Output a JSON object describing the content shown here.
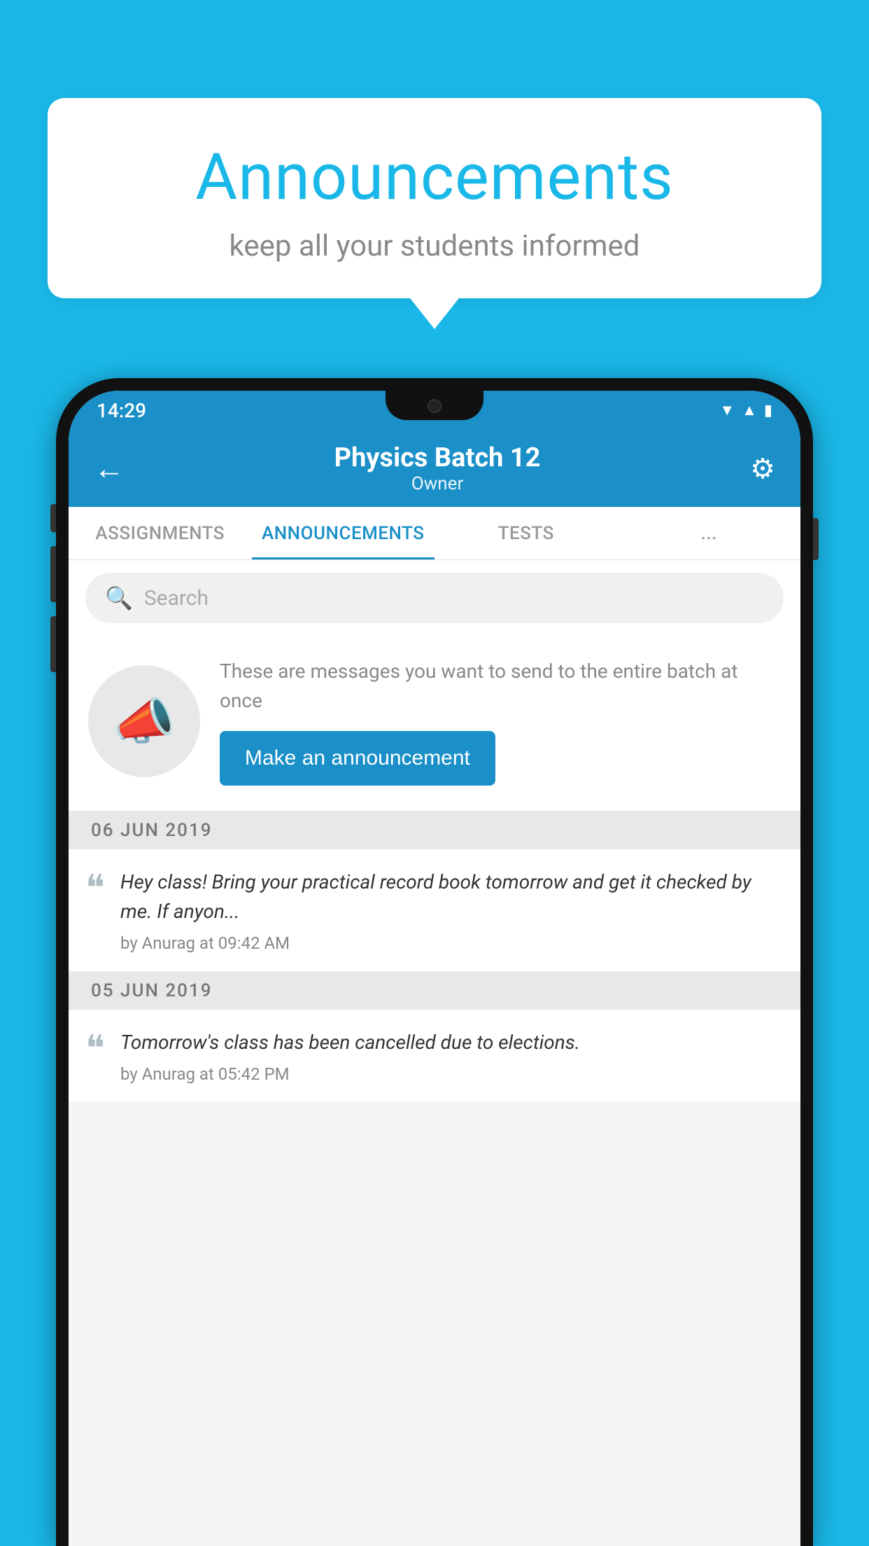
{
  "background_color": "#1ab8e8",
  "speech_bubble": {
    "title": "Announcements",
    "subtitle": "keep all your students informed"
  },
  "phone": {
    "status_bar": {
      "time": "14:29",
      "wifi": "▼",
      "signal": "▲",
      "battery": "▮"
    },
    "header": {
      "back_label": "←",
      "title": "Physics Batch 12",
      "subtitle": "Owner",
      "settings_label": "⚙"
    },
    "tabs": [
      {
        "label": "ASSIGNMENTS",
        "active": false
      },
      {
        "label": "ANNOUNCEMENTS",
        "active": true
      },
      {
        "label": "TESTS",
        "active": false
      },
      {
        "label": "...",
        "active": false
      }
    ],
    "search": {
      "placeholder": "Search"
    },
    "promo": {
      "description": "These are messages you want to send to the entire batch at once",
      "button_label": "Make an announcement"
    },
    "announcements": [
      {
        "date": "06  JUN  2019",
        "text": "Hey class! Bring your practical record book tomorrow and get it checked by me. If anyon...",
        "author": "by Anurag at 09:42 AM"
      },
      {
        "date": "05  JUN  2019",
        "text": "Tomorrow's class has been cancelled due to elections.",
        "author": "by Anurag at 05:42 PM"
      }
    ]
  }
}
